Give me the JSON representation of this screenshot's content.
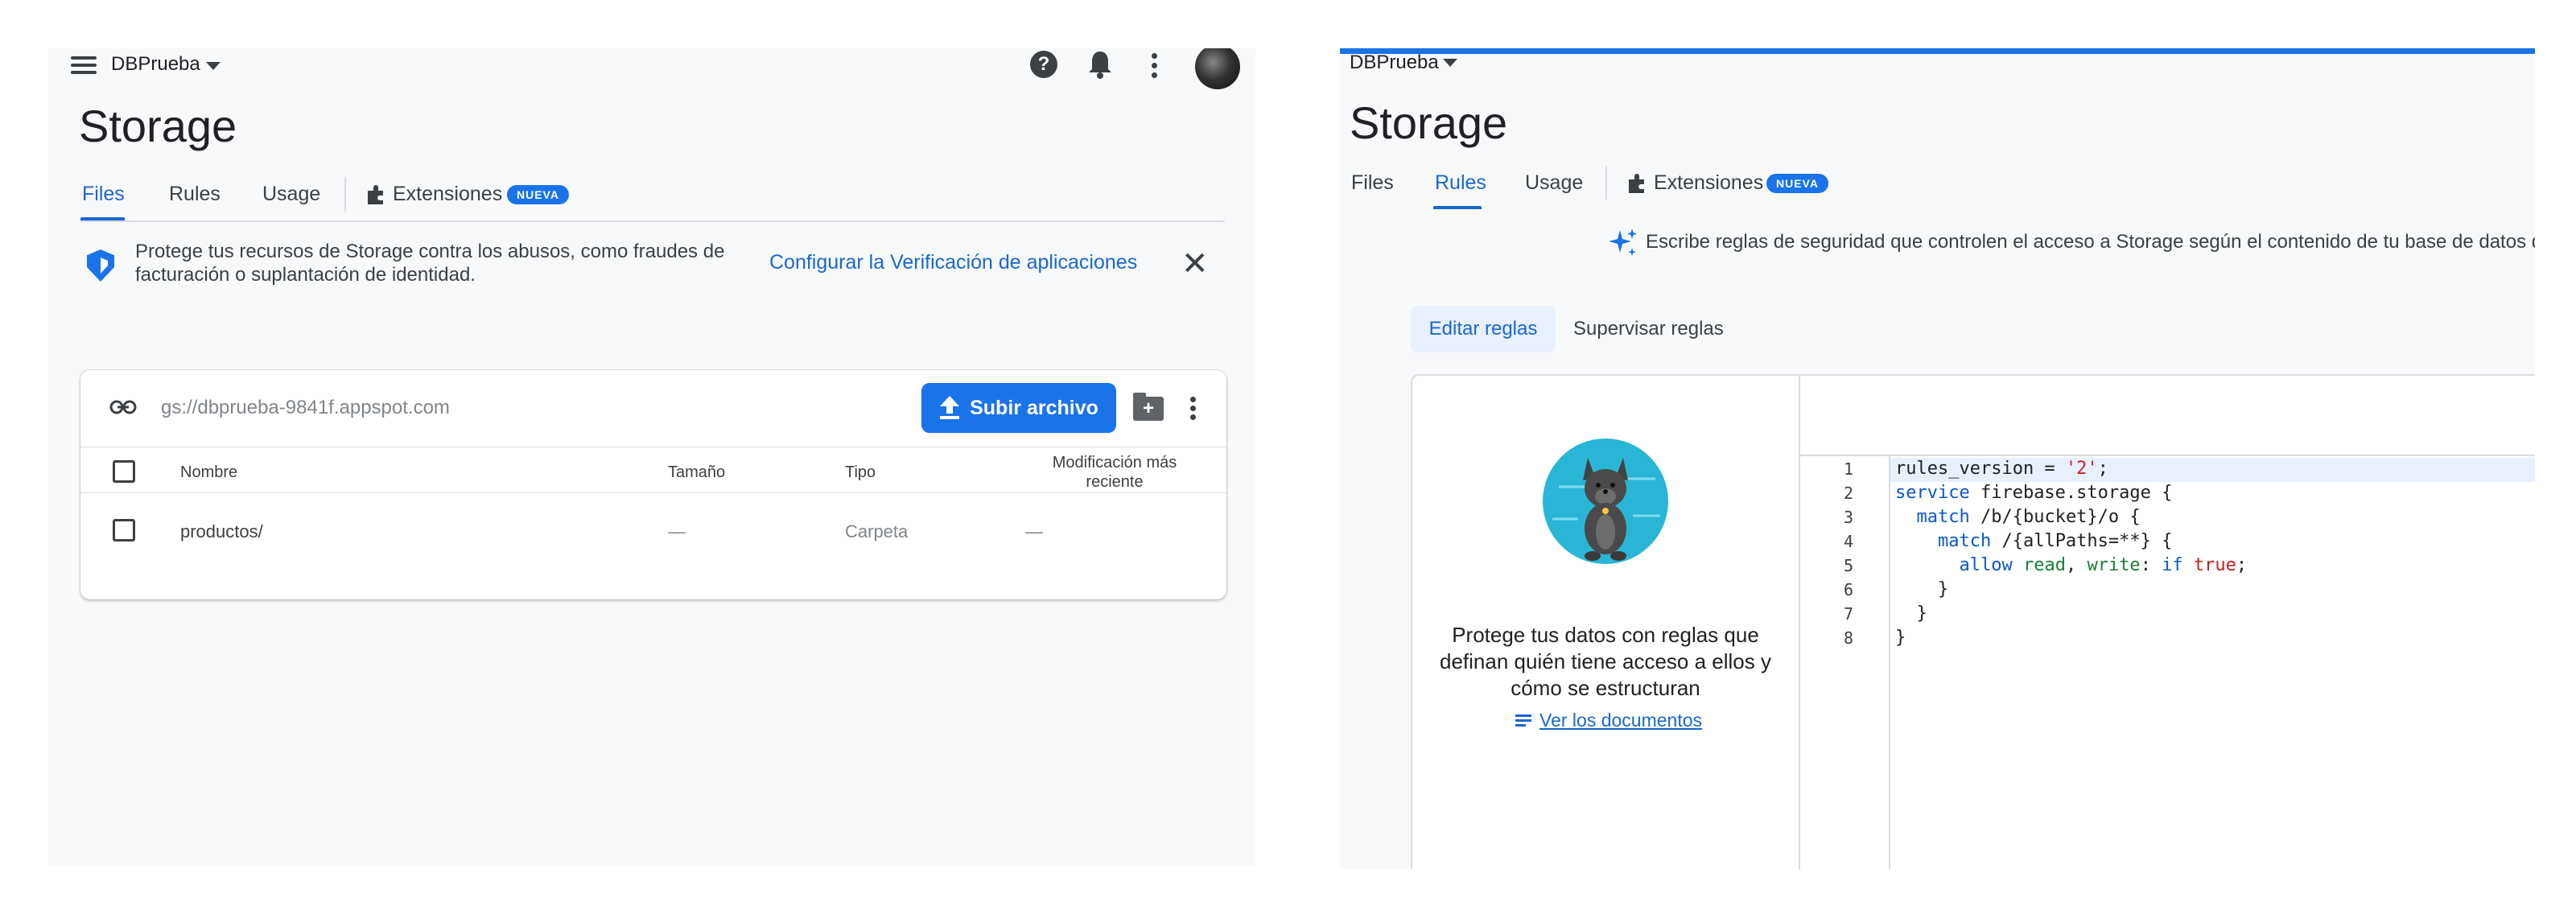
{
  "left": {
    "project_name": "DBPrueba",
    "help_icon": "help-icon",
    "bell_icon": "bell-icon",
    "page_title": "Storage",
    "tabs": [
      {
        "label": "Files",
        "active": true
      },
      {
        "label": "Rules",
        "active": false
      },
      {
        "label": "Usage",
        "active": false
      },
      {
        "label": "Extensiones",
        "active": false
      }
    ],
    "extensions_badge": "NUEVA",
    "banner": {
      "text_line1": "Protege tus recursos de Storage contra los abusos, como fraudes de",
      "text_line2": "facturación o suplantación de identidad.",
      "link": "Configurar la Verificación de aplicaciones",
      "close_glyph": "✕"
    },
    "files": {
      "bucket_path": "gs://dbprueba-9841f.appspot.com",
      "upload_label": "Subir archivo",
      "columns": {
        "name": "Nombre",
        "size": "Tamaño",
        "type": "Tipo",
        "modified_line1": "Modificación más",
        "modified_line2": "reciente"
      },
      "rows": [
        {
          "name": "productos/",
          "size": "—",
          "type": "Carpeta",
          "modified": "—"
        }
      ]
    }
  },
  "right": {
    "project_name": "DBPrueba",
    "page_title": "Storage",
    "tabs": [
      {
        "label": "Files",
        "active": false
      },
      {
        "label": "Rules",
        "active": true
      },
      {
        "label": "Usage",
        "active": false
      },
      {
        "label": "Extensiones",
        "active": false
      }
    ],
    "extensions_badge": "NUEVA",
    "info_text": "Escribe reglas de seguridad que controlen el acceso a Storage según el contenido de tu base de datos de Fires",
    "subtabs": [
      {
        "label": "Editar reglas",
        "active": true
      },
      {
        "label": "Supervisar reglas",
        "active": false
      }
    ],
    "mascot_text_lines": [
      "Protege tus datos con reglas que",
      "definan quién tiene acceso a ellos y",
      "cómo se estructuran"
    ],
    "docs_link": "Ver los documentos",
    "line_numbers": [
      "1",
      "2",
      "3",
      "4",
      "5",
      "6",
      "7",
      "8"
    ]
  },
  "colors": {
    "accent": "#1a73e8",
    "panel_bg": "#f8f9fa",
    "mascot_bg": "#29b6d6"
  }
}
